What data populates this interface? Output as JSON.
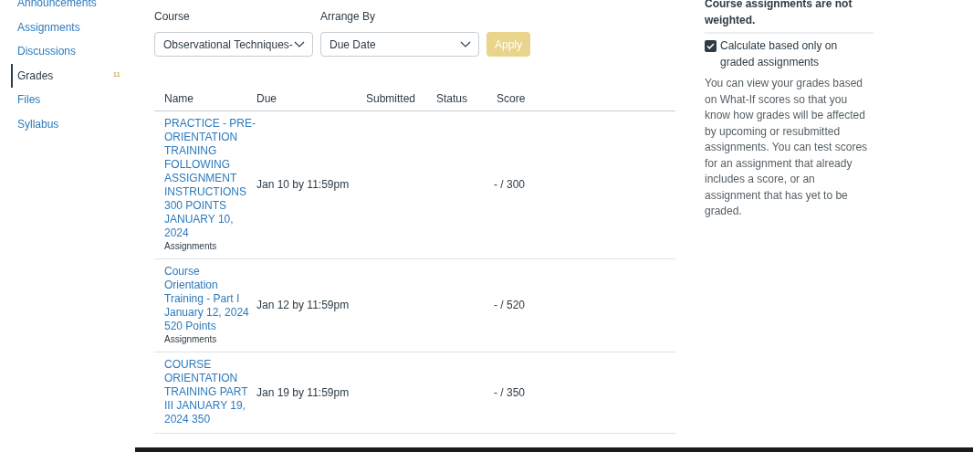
{
  "sidebar": {
    "items": [
      {
        "label": "Announcements",
        "selected": false
      },
      {
        "label": "Assignments",
        "selected": false
      },
      {
        "label": "Discussions",
        "selected": false
      },
      {
        "label": "Grades",
        "selected": true,
        "badge": "11"
      },
      {
        "label": "Files",
        "selected": false
      },
      {
        "label": "Syllabus",
        "selected": false
      }
    ]
  },
  "filters": {
    "course": {
      "label": "Course",
      "value": "Observational Techniques-"
    },
    "arrange_by": {
      "label": "Arrange By",
      "value": "Due Date"
    },
    "apply_button": {
      "label": "Apply",
      "disabled": true
    }
  },
  "table": {
    "columns": [
      "Name",
      "Due",
      "Submitted",
      "Status",
      "Score"
    ],
    "rows": [
      {
        "name": "PRACTICE - PRE-ORIENTATION TRAINING FOLLOWING ASSIGNMENT INSTRUCTIONS 300 POINTS JANUARY 10, 2024",
        "group": "Assignments",
        "due": "Jan 10 by 11:59pm",
        "score": "- / 300"
      },
      {
        "name": "Course Orientation Training - Part I January 12, 2024 520 Points",
        "group": "Assignments",
        "due": "Jan 12 by 11:59pm",
        "score": "- / 520"
      },
      {
        "name": "COURSE ORIENTATION TRAINING PART III JANUARY 19, 2024 350",
        "due": "Jan 19 by 11:59pm",
        "score": "- / 350"
      }
    ]
  },
  "side_panel": {
    "weight_note": "Course assignments are not weighted.",
    "calculate_option": {
      "label": "Calculate based only on graded assignments",
      "checked": true
    },
    "what_if_text": "You can view your grades based on What-If scores so that you know how grades will be affected by upcoming or resubmitted assignments. You can test scores for an assignment that already includes a score, or an assignment that has yet to be graded."
  }
}
